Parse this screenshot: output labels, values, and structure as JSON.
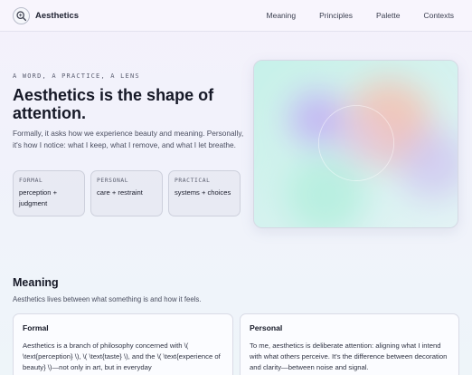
{
  "header": {
    "brand": "Aesthetics",
    "logo_icon": "magnifier-icon",
    "nav": [
      "Meaning",
      "Principles",
      "Palette",
      "Contexts"
    ]
  },
  "hero": {
    "eyebrow": "A WORD, A PRACTICE, A LENS",
    "title": "Aesthetics is the shape of attention.",
    "description": "Formally, it asks how we experience beauty and meaning. Personally, it's how I notice: what I keep, what I remove, and what I let breathe.",
    "cards": [
      {
        "label": "FORMAL",
        "value": "perception + judgment"
      },
      {
        "label": "PERSONAL",
        "value": "care + restraint"
      },
      {
        "label": "PRACTICAL",
        "value": "systems + choices"
      }
    ]
  },
  "meaning": {
    "title": "Meaning",
    "subtitle": "Aesthetics lives between what something is and how it feels.",
    "panels": [
      {
        "title": "Formal",
        "text": "Aesthetics is a branch of philosophy concerned with \\( \\text{perception} \\), \\( \\text{taste} \\), and the \\( \\text{experience of beauty} \\)—not only in art, but in everyday"
      },
      {
        "title": "Personal",
        "text": "To me, aesthetics is deliberate attention: aligning what I intend with what others perceive. It's the difference between decoration and clarity—between noise and signal."
      }
    ]
  },
  "colors": {
    "accent_teal": "#bff0e6",
    "accent_purple": "#b9a4f4",
    "accent_peach": "#f4b7a6"
  }
}
